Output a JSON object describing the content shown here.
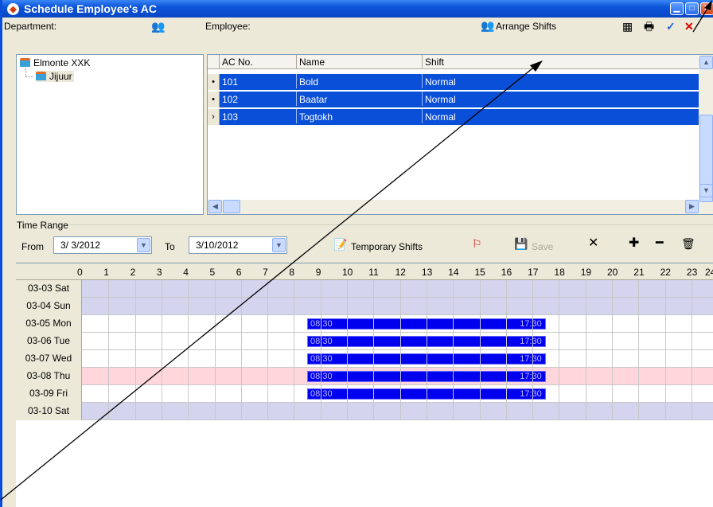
{
  "window": {
    "title": "Schedule Employee's AC"
  },
  "department": {
    "label": "Department:",
    "tree": [
      {
        "label": "Elmonte XXK"
      },
      {
        "label": "Jijuur"
      }
    ]
  },
  "employee": {
    "label": "Employee:",
    "arrange_shifts": "Arrange Shifts",
    "columns": [
      "AC No.",
      "Name",
      "Shift"
    ],
    "rows": [
      {
        "indicator": "•",
        "ac_no": "101",
        "name": "Bold",
        "shift": "Normal"
      },
      {
        "indicator": "•",
        "ac_no": "102",
        "name": "Baatar",
        "shift": "Normal"
      },
      {
        "indicator": "›",
        "ac_no": "103",
        "name": "Togtokh",
        "shift": "Normal"
      }
    ]
  },
  "time_range": {
    "legend": "Time Range",
    "from_label": "From",
    "from_value": "3/ 3/2012",
    "to_label": "To",
    "to_value": "3/10/2012",
    "temporary_shifts": "Temporary Shifts",
    "save": "Save"
  },
  "schedule": {
    "hours": [
      "0",
      "1",
      "2",
      "3",
      "4",
      "5",
      "6",
      "7",
      "8",
      "9",
      "10",
      "11",
      "12",
      "13",
      "14",
      "15",
      "16",
      "17",
      "18",
      "19",
      "20",
      "21",
      "22",
      "23",
      "24"
    ],
    "days": [
      {
        "label": "03-03 Sat",
        "type": "weekend"
      },
      {
        "label": "03-04 Sun",
        "type": "weekend"
      },
      {
        "label": "03-05 Mon",
        "type": "work",
        "start": "08:30",
        "end": "17:30"
      },
      {
        "label": "03-06 Tue",
        "type": "work",
        "start": "08:30",
        "end": "17:30"
      },
      {
        "label": "03-07 Wed",
        "type": "work",
        "start": "08:30",
        "end": "17:30"
      },
      {
        "label": "03-08 Thu",
        "type": "holiday",
        "start": "08:30",
        "end": "17:30"
      },
      {
        "label": "03-09 Fri",
        "type": "work",
        "start": "08:30",
        "end": "17:30"
      },
      {
        "label": "03-10 Sat",
        "type": "weekend"
      }
    ]
  },
  "colors": {
    "weekend": "#d4d4ee",
    "holiday": "#ffd6dc",
    "selection": "#0a4fd8",
    "shift_bar": "#0000ee"
  }
}
